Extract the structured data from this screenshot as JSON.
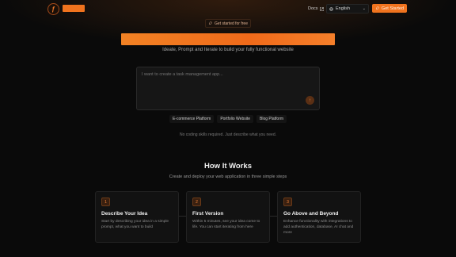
{
  "header": {
    "docs_label": "Docs",
    "docs_icon": "external-link-icon",
    "language": "English",
    "language_icon": "globe-icon",
    "get_started_label": "Get Started",
    "get_started_icon": "rocket-icon"
  },
  "hero": {
    "pill_label": "Get started for free",
    "subtitle": "Ideate, Prompt and Iterate to build your fully functional website",
    "prompt_placeholder": "I want to create a task management app...",
    "send_icon": "arrow-up-icon",
    "chips": [
      "E-commerce Platform",
      "Portfolio Website",
      "Blog Platform"
    ],
    "note": "No coding skills required. Just describe what you need."
  },
  "how": {
    "title": "How It Works",
    "subtitle": "Create and deploy your web application in three simple steps",
    "steps": [
      {
        "num": "1",
        "title": "Describe Your Idea",
        "desc": "Start by describing your idea in a simple prompt, what you want to build"
      },
      {
        "num": "2",
        "title": "First Version",
        "desc": "Within 5 minutes, see your idea come to life. You can start iterating from here"
      },
      {
        "num": "3",
        "title": "Go Above and Beyond",
        "desc": "Enhance functionality with integrations to add authentication, database, AI chat and more"
      }
    ]
  },
  "colors": {
    "accent": "#f0731e",
    "background": "#0a0a0a"
  }
}
